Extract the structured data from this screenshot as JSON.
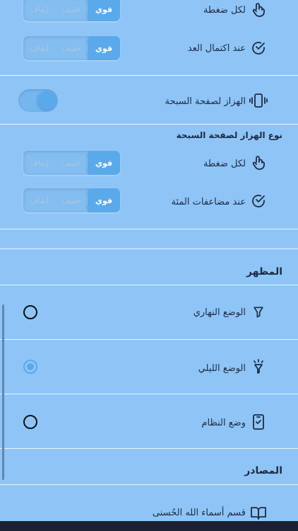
{
  "seg_options": {
    "strong": "قوي",
    "light": "خفيف",
    "off": "إيقاف"
  },
  "counting": {
    "per_tap_label": "لكل ضغطة",
    "on_complete_label": "عند اكتمال العد"
  },
  "page_vibration": {
    "label": "الهزاز لصفحة السبحة",
    "enabled": true
  },
  "vibration_type": {
    "title": "نوع الهزاز لصفحة السبحة",
    "per_tap_label": "لكل ضغطة",
    "hundreds_label": "عند مضاعفات المئة"
  },
  "appearance": {
    "title": "المظهر",
    "day_mode": "الوضع النهاري",
    "night_mode": "الوضع الليلي",
    "system_mode": "وضع النظام",
    "selected": "night_mode"
  },
  "sources": {
    "title": "المصادر",
    "names_section": "قسم أسماء الله الحُسنى"
  },
  "colors": {
    "background": "#8ec5f6",
    "accent": "#5aa9ea",
    "divider": "#e9f3fd",
    "text": "#1f2a44"
  },
  "icons": {
    "tap": "hand-tap-icon",
    "check": "check-circle-icon",
    "vibrate": "phone-vibrate-icon",
    "day": "lamp-off-icon",
    "night": "lamp-on-icon",
    "system": "phone-check-icon",
    "book": "open-book-icon"
  }
}
